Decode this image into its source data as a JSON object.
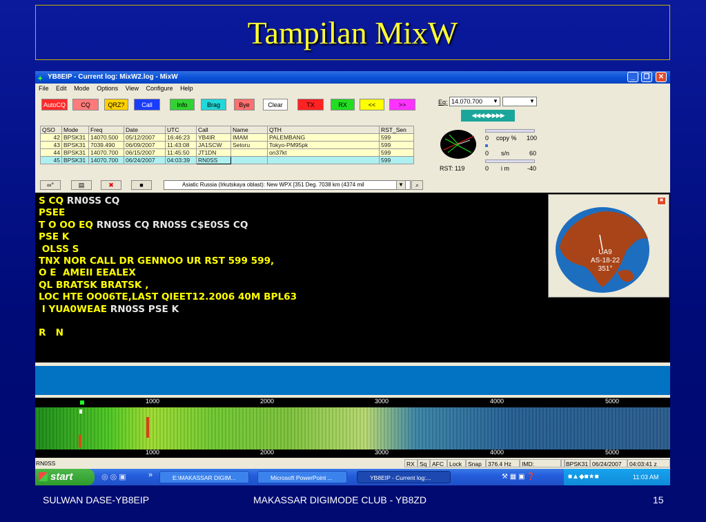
{
  "slide": {
    "title": "Tampilan MixW",
    "footer_left": "SULWAN DASE-YB8EIP",
    "footer_center": "MAKASSAR DIGIMODE CLUB - YB8ZD",
    "page_number": "15"
  },
  "window": {
    "title": "YB8EIP - Current log: MixW2.log - MixW",
    "menu": [
      "File",
      "Edit",
      "Mode",
      "Options",
      "View",
      "Configure",
      "Help"
    ]
  },
  "macro_buttons": [
    {
      "label": "AutoCQ",
      "color": "#ff2a2a",
      "text": "#ffffff"
    },
    {
      "label": "CQ",
      "color": "#ff7a7a",
      "text": "#000000"
    },
    {
      "label": "QRZ?",
      "color": "#ffd000",
      "text": "#000000"
    },
    {
      "label": "Call",
      "color": "#1a3cff",
      "text": "#ffffff"
    },
    {
      "label": "Info",
      "color": "#32d232",
      "text": "#000000"
    },
    {
      "label": "Brag",
      "color": "#22d8d8",
      "text": "#000000"
    },
    {
      "label": "Bye",
      "color": "#ff7070",
      "text": "#000000"
    },
    {
      "label": "Clear",
      "color": "#ffffff",
      "text": "#000000"
    },
    {
      "label": "TX",
      "color": "#ff2222",
      "text": "#000000"
    },
    {
      "label": "RX",
      "color": "#22dd22",
      "text": "#000000"
    },
    {
      "label": "<<",
      "color": "#ffff00",
      "text": "#000000"
    },
    {
      "label": ">>",
      "color": "#ff33ff",
      "text": "#000000"
    }
  ],
  "log": {
    "columns": [
      "QSO",
      "Mode",
      "Freq",
      "Date",
      "UTC",
      "Call",
      "Name",
      "QTH",
      "RST_Sen"
    ],
    "rows": [
      [
        "42",
        "BPSK31",
        "14070.500",
        "05/12/2007",
        "16:46:23",
        "YB4IR",
        "IMAM",
        "PALEMBANG",
        "599"
      ],
      [
        "43",
        "BPSK31",
        "7039.490",
        "06/09/2007",
        "11:43:08",
        "JA1SCW",
        "Setoru",
        "Tokyo-PM95pk",
        "599"
      ],
      [
        "44",
        "BPSK31",
        "14070.700",
        "06/15/2007",
        "11:45:50",
        "JT1DN",
        "",
        "on37kt",
        "599"
      ],
      [
        "45",
        "BPSK31",
        "14070.700",
        "06/24/2007",
        "04:03:39",
        "RN0SS",
        "",
        "",
        "599"
      ]
    ]
  },
  "toolbar2": {
    "buttons": [
      "∞°",
      "▤",
      "✖",
      "■"
    ],
    "info": "Asiatic Russia (Irkutskaya oblast): New WPX [351 Deg. 7038 km (4374 mil"
  },
  "freq_panel": {
    "label": "Eq:",
    "value": "14.070.700",
    "arrows": "◀◀◀◀▶▶▶▶",
    "rst": "RST: 119",
    "copy_row": [
      "0",
      "copy %",
      "100"
    ],
    "sn_row": [
      "0",
      "s/n",
      "60"
    ],
    "imd_row": [
      "0",
      "i m",
      "-40"
    ]
  },
  "rx_lines": [
    [
      {
        "t": "S CQ ",
        "c": "y"
      },
      {
        "t": "RN0SS CQ",
        "c": "w"
      }
    ],
    [
      {
        "t": "PSEE",
        "c": "y"
      }
    ],
    [
      {
        "t": "T O OO EQ ",
        "c": "y"
      },
      {
        "t": "RN0SS CQ RN0SS C$E0SS CQ",
        "c": "w"
      }
    ],
    [
      {
        "t": "PSE K",
        "c": "y"
      }
    ],
    [
      {
        "t": " OLSS S",
        "c": "y"
      }
    ],
    [
      {
        "t": "TNX NOR CALL DR GENNOO UR RST 599 599,",
        "c": "y"
      }
    ],
    [
      {
        "t": "O E  AMEII EEALEX",
        "c": "y"
      }
    ],
    [
      {
        "t": "QL BRATSK BRATSK ,",
        "c": "y"
      }
    ],
    [
      {
        "t": "LOC HTE OO06TE,LAST QIEET12.2006 40M BPL63",
        "c": "y"
      }
    ],
    [
      {
        "t": " I YUA0WEAE ",
        "c": "y"
      },
      {
        "t": "RN0SS PSE K",
        "c": "w"
      }
    ],
    [
      {
        "t": "",
        "c": "y"
      }
    ],
    [
      {
        "t": "R   N",
        "c": "y"
      }
    ]
  ],
  "globe": {
    "close": "✖",
    "label_lines": [
      "UA9",
      "AS-18-22",
      "351°"
    ]
  },
  "ruler_labels": [
    "1000",
    "2000",
    "3000",
    "4000",
    "5000"
  ],
  "status": {
    "left": "RN0SS",
    "cells": [
      "RX",
      "Sq",
      "AFC",
      "Lock",
      "Snap",
      "376.4 Hz",
      "IMD:",
      "",
      "BPSK31",
      "06/24/2007",
      "04:03:41 z"
    ]
  },
  "taskbar": {
    "start": "start",
    "chev": "»",
    "tasks": [
      "E:\\MAKASSAR DIGIM...",
      "Microsoft PowerPoint ...",
      "YB8EIP - Current log:..."
    ],
    "clock": "11:03 AM"
  }
}
